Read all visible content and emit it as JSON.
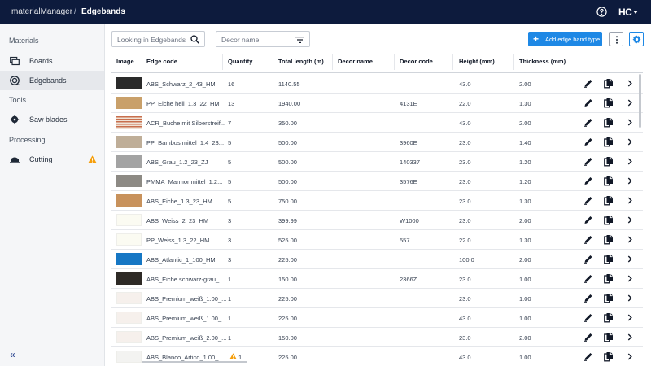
{
  "header": {
    "app_name": "materialManager",
    "separator": "/",
    "page_title": "Edgebands",
    "logo_text": "HC",
    "help_icon": "help-circle-icon"
  },
  "sidebar": {
    "sections": [
      {
        "title": "Materials",
        "items": [
          {
            "label": "Boards",
            "icon": "boards-icon",
            "active": false
          },
          {
            "label": "Edgebands",
            "icon": "edgeband-roll-icon",
            "active": true
          }
        ]
      },
      {
        "title": "Tools",
        "items": [
          {
            "label": "Saw blades",
            "icon": "saw-blade-icon",
            "active": false
          }
        ]
      },
      {
        "title": "Processing",
        "items": [
          {
            "label": "Cutting",
            "icon": "cutting-icon",
            "active": false,
            "warning": true
          }
        ]
      }
    ],
    "collapse_label": "«"
  },
  "toolbar": {
    "search_placeholder": "Looking in Edgebands",
    "filter_placeholder": "Decor name",
    "add_button_label": "Add edge band type",
    "add_button_icon": "plus-icon",
    "more_icon": "more-vertical-icon",
    "settings_icon": "gear-icon"
  },
  "table": {
    "columns": [
      "Image",
      "Edge code",
      "Quantity",
      "Total length (m)",
      "Decor name",
      "Decor code",
      "Height (mm)",
      "Thickness (mm)"
    ],
    "rows": [
      {
        "swatch": "#2a2a2a",
        "edge_code": "ABS_Schwarz_2_43_HM",
        "quantity": "16",
        "total_length": "1140.55",
        "decor_name": "",
        "decor_code": "",
        "height": "43.0",
        "thickness": "2.00",
        "warning": false
      },
      {
        "swatch": "#c9a06a",
        "edge_code": "PP_Eiche hell_1.3_22_HM",
        "quantity": "13",
        "total_length": "1940.00",
        "decor_name": "",
        "decor_code": "4131E",
        "height": "22.0",
        "thickness": "1.30",
        "warning": false
      },
      {
        "swatch": "stripes",
        "edge_code": "ACR_Buche mit Silberstreif...",
        "quantity": "7",
        "total_length": "350.00",
        "decor_name": "",
        "decor_code": "",
        "height": "43.0",
        "thickness": "2.00",
        "warning": false
      },
      {
        "swatch": "#bfae98",
        "edge_code": "PP_Bambus mittel_1.4_23...",
        "quantity": "5",
        "total_length": "500.00",
        "decor_name": "",
        "decor_code": "3960E",
        "height": "23.0",
        "thickness": "1.40",
        "warning": false
      },
      {
        "swatch": "#a3a3a3",
        "edge_code": "ABS_Grau_1.2_23_ZJ",
        "quantity": "5",
        "total_length": "500.00",
        "decor_name": "",
        "decor_code": "140337",
        "height": "23.0",
        "thickness": "1.20",
        "warning": false
      },
      {
        "swatch": "#8d8a84",
        "edge_code": "PMMA_Marmor mittel_1.2...",
        "quantity": "5",
        "total_length": "500.00",
        "decor_name": "",
        "decor_code": "3576E",
        "height": "23.0",
        "thickness": "1.20",
        "warning": false
      },
      {
        "swatch": "#c8925c",
        "edge_code": "ABS_Eiche_1.3_23_HM",
        "quantity": "5",
        "total_length": "750.00",
        "decor_name": "",
        "decor_code": "",
        "height": "23.0",
        "thickness": "1.30",
        "warning": false
      },
      {
        "swatch": "#fbfbf2",
        "edge_code": "ABS_Weiss_2_23_HM",
        "quantity": "3",
        "total_length": "399.99",
        "decor_name": "",
        "decor_code": "W1000",
        "height": "23.0",
        "thickness": "2.00",
        "warning": false
      },
      {
        "swatch": "#fbfbf2",
        "edge_code": "PP_Weiss_1.3_22_HM",
        "quantity": "3",
        "total_length": "525.00",
        "decor_name": "",
        "decor_code": "557",
        "height": "22.0",
        "thickness": "1.30",
        "warning": false
      },
      {
        "swatch": "#1677c4",
        "edge_code": "ABS_Atlantic_1_100_HM",
        "quantity": "3",
        "total_length": "225.00",
        "decor_name": "",
        "decor_code": "",
        "height": "100.0",
        "thickness": "2.00",
        "warning": false
      },
      {
        "swatch": "#2e2a26",
        "edge_code": "ABS_Eiche schwarz-grau_...",
        "quantity": "1",
        "total_length": "150.00",
        "decor_name": "",
        "decor_code": "2366Z",
        "height": "23.0",
        "thickness": "1.00",
        "warning": false
      },
      {
        "swatch": "#f6f0ec",
        "edge_code": "ABS_Premium_weiß_1.00_...",
        "quantity": "1",
        "total_length": "225.00",
        "decor_name": "",
        "decor_code": "",
        "height": "23.0",
        "thickness": "1.00",
        "warning": false
      },
      {
        "swatch": "#f6f0ec",
        "edge_code": "ABS_Premium_weiß_1.00_...",
        "quantity": "1",
        "total_length": "225.00",
        "decor_name": "",
        "decor_code": "",
        "height": "43.0",
        "thickness": "1.00",
        "warning": false
      },
      {
        "swatch": "#f6f0ec",
        "edge_code": "ABS_Premium_weiß_2.00_...",
        "quantity": "1",
        "total_length": "150.00",
        "decor_name": "",
        "decor_code": "",
        "height": "23.0",
        "thickness": "2.00",
        "warning": false
      },
      {
        "swatch": "#f3f3f1",
        "edge_code": "ABS_Blanco_Artico_1.00_...",
        "quantity": "1",
        "total_length": "225.00",
        "decor_name": "",
        "decor_code": "",
        "height": "43.0",
        "thickness": "1.00",
        "warning": true
      }
    ],
    "row_actions": [
      "edit-pencil-icon",
      "copy-icon",
      "chevron-right-icon"
    ]
  },
  "colors": {
    "topbar": "#0d1b3d",
    "accent": "#1e88e5",
    "warning": "#f59e0b"
  }
}
